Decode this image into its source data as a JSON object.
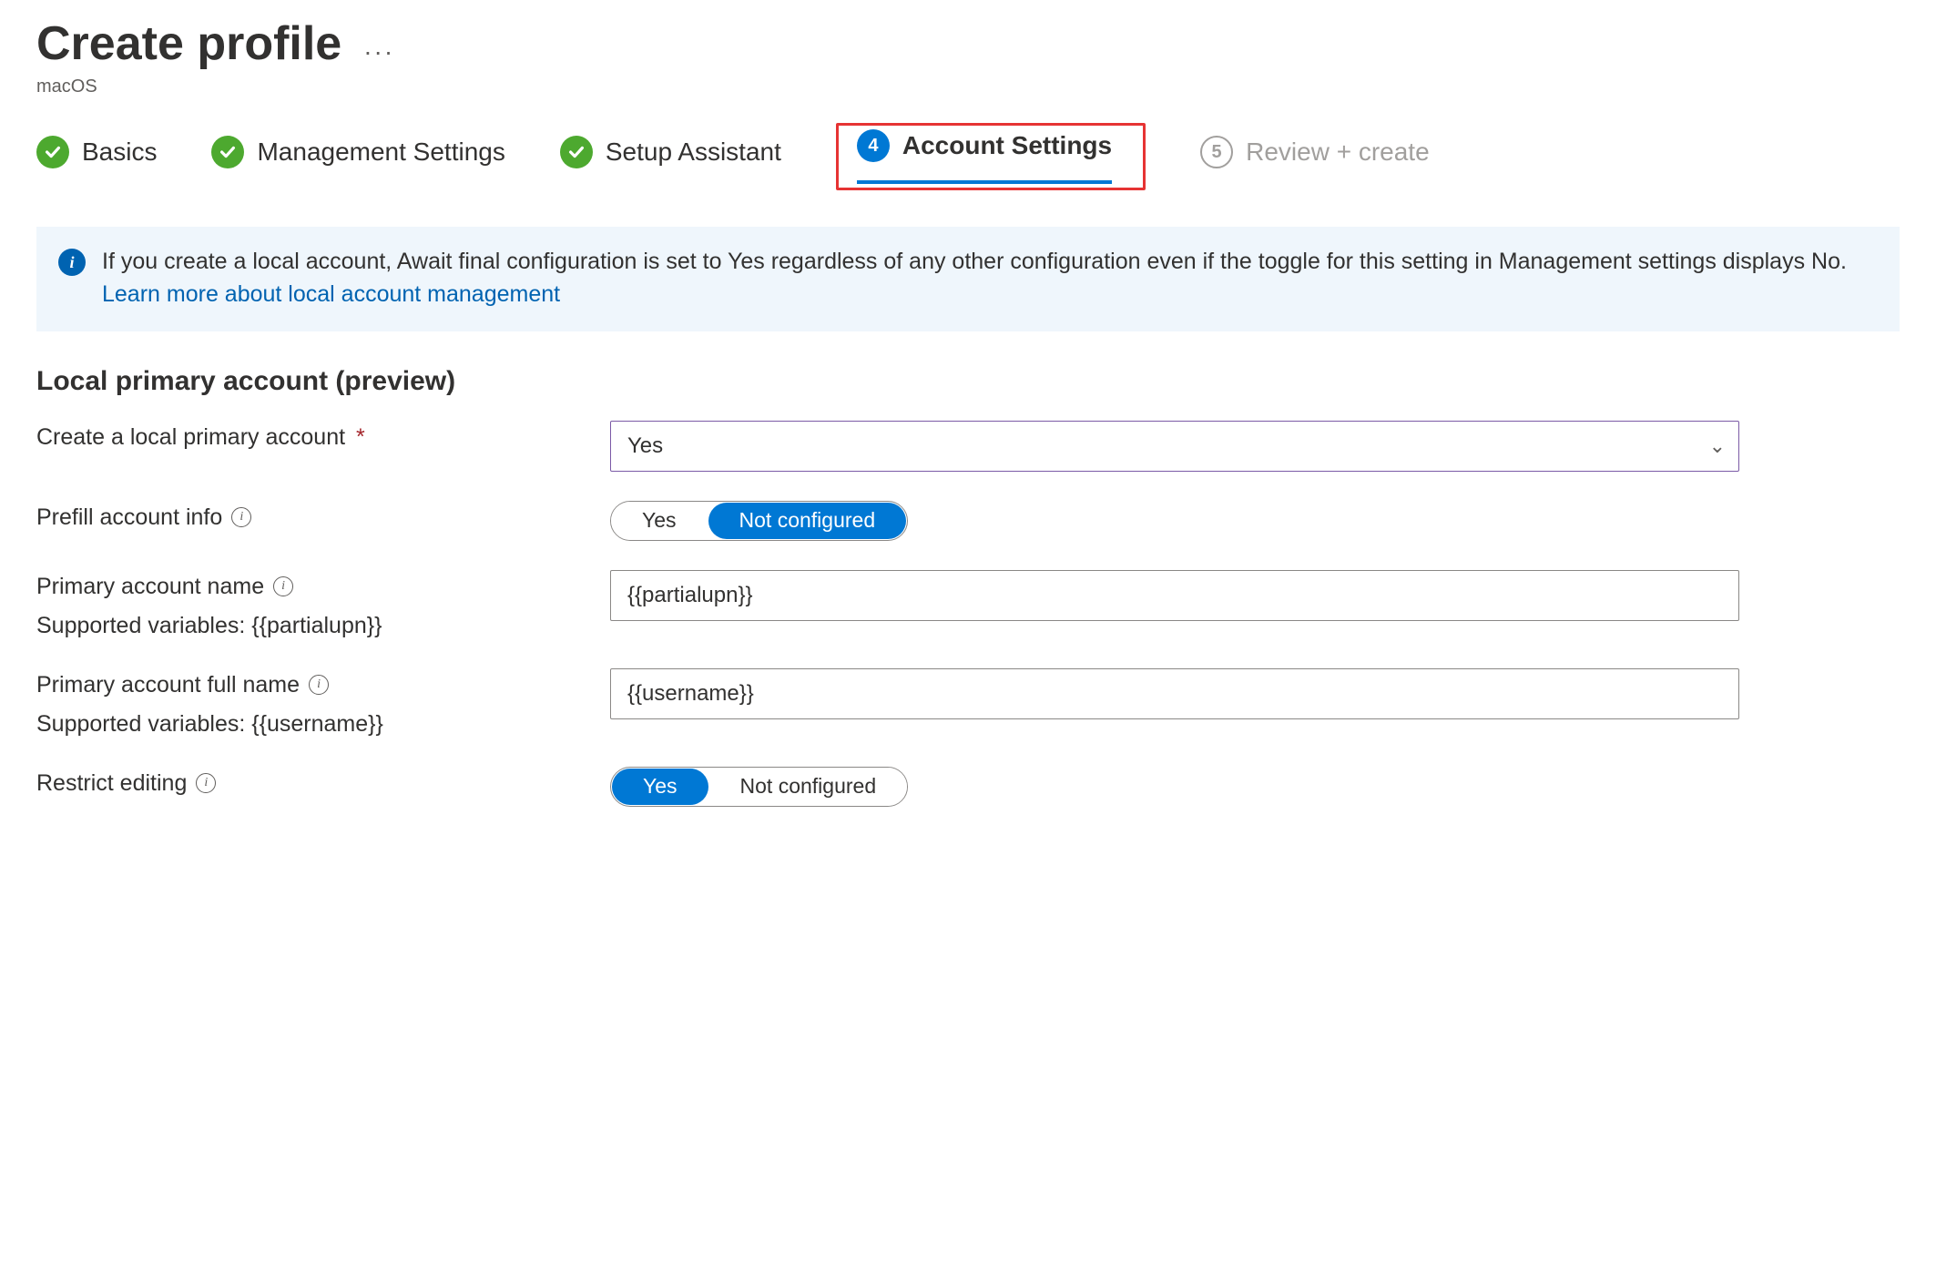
{
  "page": {
    "title": "Create profile",
    "subtitle": "macOS"
  },
  "steps": {
    "s1": "Basics",
    "s2": "Management Settings",
    "s3": "Setup Assistant",
    "s4": "Account Settings",
    "s4_num": "4",
    "s5": "Review + create",
    "s5_num": "5"
  },
  "banner": {
    "text_a": "If you create a local account, Await final configuration is set to Yes regardless of any other configuration even if the toggle for this setting in Management settings displays No. ",
    "link": "Learn more about local account management"
  },
  "section": {
    "heading": "Local primary account (preview)"
  },
  "fields": {
    "create_local": {
      "label": "Create a local primary account",
      "value": "Yes"
    },
    "prefill": {
      "label": "Prefill account info",
      "opt_yes": "Yes",
      "opt_no": "Not configured"
    },
    "acct_name": {
      "label": "Primary account name",
      "value": "{{partialupn}}",
      "hint": "Supported variables: {{partialupn}}"
    },
    "acct_full": {
      "label": "Primary account full name",
      "value": "{{username}}",
      "hint": "Supported variables: {{username}}"
    },
    "restrict": {
      "label": "Restrict editing",
      "opt_yes": "Yes",
      "opt_no": "Not configured"
    }
  }
}
